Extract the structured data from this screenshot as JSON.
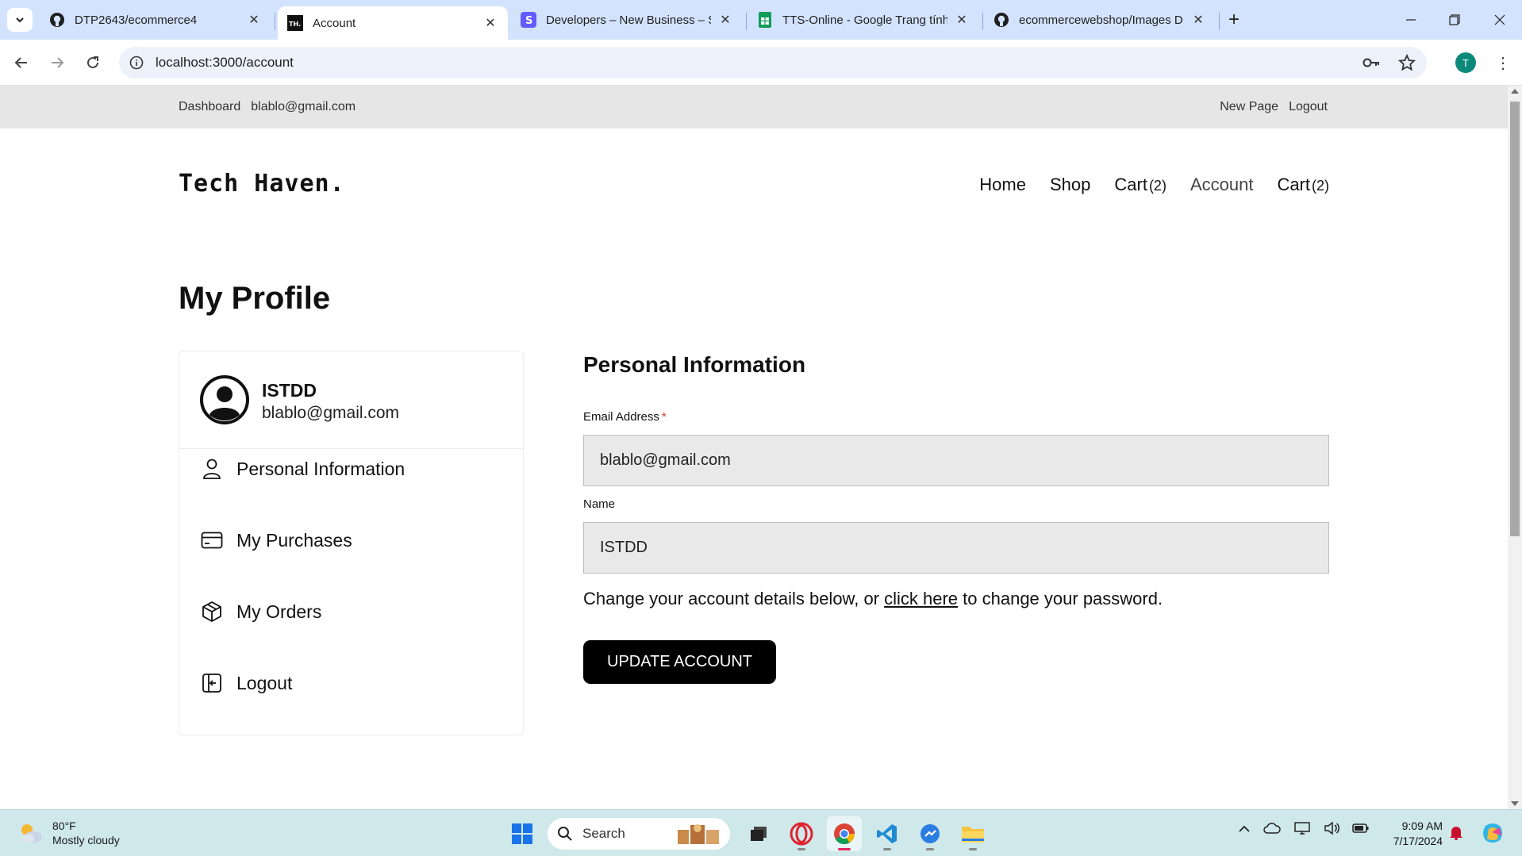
{
  "browser": {
    "tabs": [
      {
        "title": "DTP2643/ecommerce4",
        "icon": "github-icon",
        "active": false
      },
      {
        "title": "Account",
        "icon": "th-favicon",
        "favicon_text": "TH.",
        "active": true
      },
      {
        "title": "Developers – New Business – St",
        "icon": "stripe-icon",
        "active": false
      },
      {
        "title": "TTS-Online - Google Trang tính",
        "icon": "sheets-icon",
        "active": false
      },
      {
        "title": "ecommercewebshop/Images D",
        "icon": "github-icon",
        "active": false
      }
    ],
    "url": "localhost:3000/account",
    "profile_initial": "T"
  },
  "site": {
    "topbar": {
      "left": [
        "Dashboard",
        "blablo@gmail.com"
      ],
      "right": [
        "New Page",
        "Logout"
      ]
    },
    "logo": "Tech Haven.",
    "nav": [
      {
        "label": "Home",
        "count": ""
      },
      {
        "label": "Shop",
        "count": ""
      },
      {
        "label": "Cart",
        "count": "(2)"
      },
      {
        "label": "Account",
        "count": ""
      },
      {
        "label": "Cart",
        "count": "(2)"
      }
    ],
    "page_title": "My Profile",
    "sidebar": {
      "user_name": "ISTDD",
      "user_email": "blablo@gmail.com",
      "items": [
        {
          "label": "Personal Information",
          "icon": "person-icon"
        },
        {
          "label": "My Purchases",
          "icon": "credit-card-icon"
        },
        {
          "label": "My Orders",
          "icon": "package-icon"
        },
        {
          "label": "Logout",
          "icon": "logout-icon"
        }
      ]
    },
    "form": {
      "section_title": "Personal Information",
      "email_label": "Email Address",
      "required_mark": "*",
      "email_value": "blablo@gmail.com",
      "name_label": "Name",
      "name_value": "ISTDD",
      "help_before": "Change your account details below, or ",
      "help_link": "click here",
      "help_after": " to change your password.",
      "submit_label": "UPDATE ACCOUNT"
    }
  },
  "taskbar": {
    "weather_temp": "80°F",
    "weather_desc": "Mostly cloudy",
    "search_placeholder": "Search",
    "time": "9:09 AM",
    "date": "7/17/2024"
  }
}
